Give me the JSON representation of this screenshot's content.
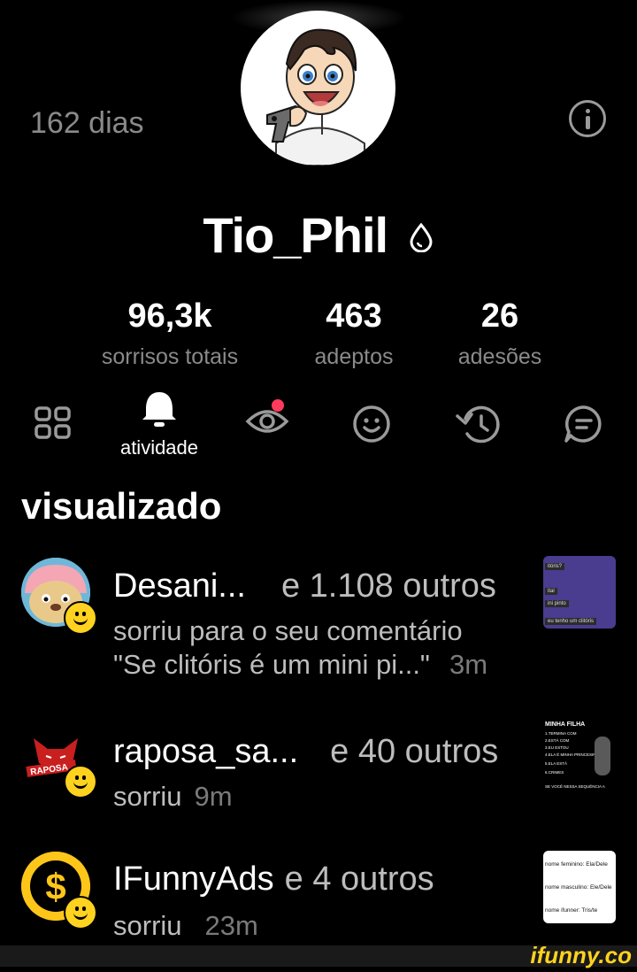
{
  "header": {
    "days": "162 dias",
    "info_icon": "info-icon"
  },
  "profile": {
    "username": "Tio_Phil",
    "badge_icon": "drop-icon"
  },
  "stats": [
    {
      "value": "96,3k",
      "label": "sorrisos totais"
    },
    {
      "value": "463",
      "label": "adeptos"
    },
    {
      "value": "26",
      "label": "adesões"
    }
  ],
  "tabs": [
    {
      "icon": "grid-icon"
    },
    {
      "icon": "bell-icon",
      "label": "atividade",
      "active": true
    },
    {
      "icon": "eye-icon",
      "dot": true
    },
    {
      "icon": "smiley-icon"
    },
    {
      "icon": "history-icon"
    },
    {
      "icon": "chat-icon"
    }
  ],
  "section": {
    "title": "visualizado"
  },
  "notifications": [
    {
      "user": "Desani...",
      "others": "e 1.108 outros",
      "action": "sorriu para o seu comentário",
      "quote": "\"Se clitóris é um mini pi...\"",
      "time": "3m",
      "thumb": [
        "itóris?",
        "ital",
        "ini pinto",
        "eu tenho um clitóris"
      ]
    },
    {
      "user": "raposa_sa...",
      "others": "e 40 outros",
      "action": "sorriu",
      "time": "9m",
      "avatar_text": "RAPOSA",
      "thumb": [
        "MINHA FILHA",
        "1.TERMINA COM",
        "2.ESTÁ COM",
        "3.EU ESTOU",
        "4.ELA É MINHA PRINCESINHA",
        "5.ELA ESTÁ",
        "6.CRIMES",
        "SE VOCÊ NESSA SEQUÊNCIA A"
      ]
    },
    {
      "user": "IFunnyAds",
      "others": "e 4 outros",
      "action": "sorriu",
      "time": "23m",
      "thumb": [
        "nome feminino: Ela/Dele",
        "nome masculino: Ele/Dele",
        "nome ifunner: Tris/te"
      ]
    }
  ],
  "watermark": "ifunny.co"
}
